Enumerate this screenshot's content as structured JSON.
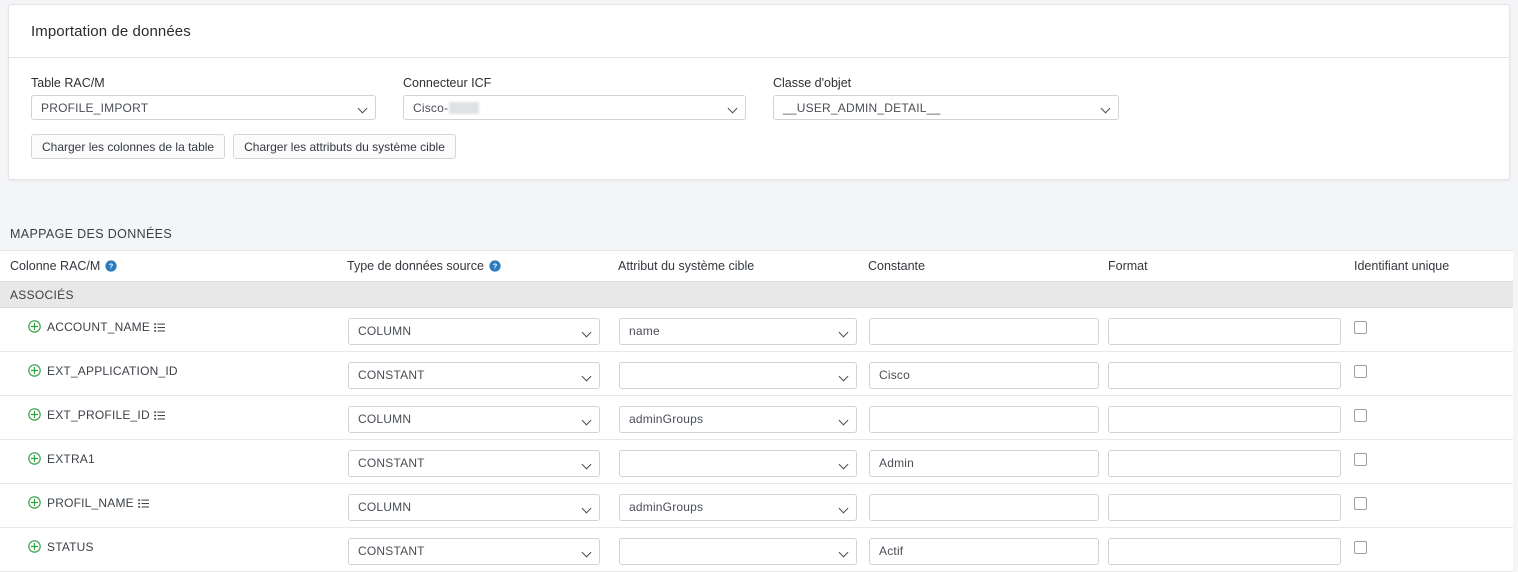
{
  "card": {
    "title": "Importation de données",
    "fields": [
      {
        "label": "Table RAC/M",
        "value": "PROFILE_IMPORT",
        "name": "table-racm-select"
      },
      {
        "label": "Connecteur ICF",
        "value": "Cisco-",
        "redacted": true,
        "name": "connecteur-icf-select"
      },
      {
        "label": "Classe d'objet",
        "value": "__USER_ADMIN_DETAIL__",
        "name": "classe-objet-select"
      }
    ],
    "buttons": [
      {
        "label": "Charger les colonnes de la table",
        "name": "load-table-columns-button"
      },
      {
        "label": "Charger les attributs du système cible",
        "name": "load-target-attributes-button"
      }
    ]
  },
  "mapping": {
    "section_title": "MAPPAGE DES DONNÉES",
    "columns": [
      {
        "label": "Colonne RAC/M",
        "help": true
      },
      {
        "label": "Type de données source",
        "help": true
      },
      {
        "label": "Attribut du système cible",
        "help": false
      },
      {
        "label": "Constante",
        "help": false
      },
      {
        "label": "Format",
        "help": false
      },
      {
        "label": "Identifiant unique",
        "help": false
      }
    ],
    "group_label": "ASSOCIÉS",
    "rows": [
      {
        "column": "ACCOUNT_NAME",
        "has_list_icon": true,
        "source_type": "COLUMN",
        "target_attribute": "name",
        "constant": "",
        "format": "",
        "unique_id": false
      },
      {
        "column": "EXT_APPLICATION_ID",
        "has_list_icon": false,
        "source_type": "CONSTANT",
        "target_attribute": "",
        "constant": "Cisco",
        "format": "",
        "unique_id": false
      },
      {
        "column": "EXT_PROFILE_ID",
        "has_list_icon": true,
        "source_type": "COLUMN",
        "target_attribute": "adminGroups",
        "constant": "",
        "format": "",
        "unique_id": false
      },
      {
        "column": "EXTRA1",
        "has_list_icon": false,
        "source_type": "CONSTANT",
        "target_attribute": "",
        "constant": "Admin",
        "format": "",
        "unique_id": false
      },
      {
        "column": "PROFIL_NAME",
        "has_list_icon": true,
        "source_type": "COLUMN",
        "target_attribute": "adminGroups",
        "constant": "",
        "format": "",
        "unique_id": false
      },
      {
        "column": "STATUS",
        "has_list_icon": false,
        "source_type": "CONSTANT",
        "target_attribute": "",
        "constant": "Actif",
        "format": "",
        "unique_id": false
      }
    ]
  },
  "colors": {
    "page_background": "#f4f5f7",
    "card_background": "#ffffff",
    "group_row": "#e8e8e8",
    "help_icon": "#2b7bbd",
    "plus_icon": "#2e9e43",
    "border": "#cfd2d6",
    "text": "#3d4248"
  },
  "icons": {
    "plus_circle": "plus-circle-icon",
    "list": "list-icon",
    "help": "help-circle-icon",
    "chevron_down": "chevron-down-icon"
  }
}
